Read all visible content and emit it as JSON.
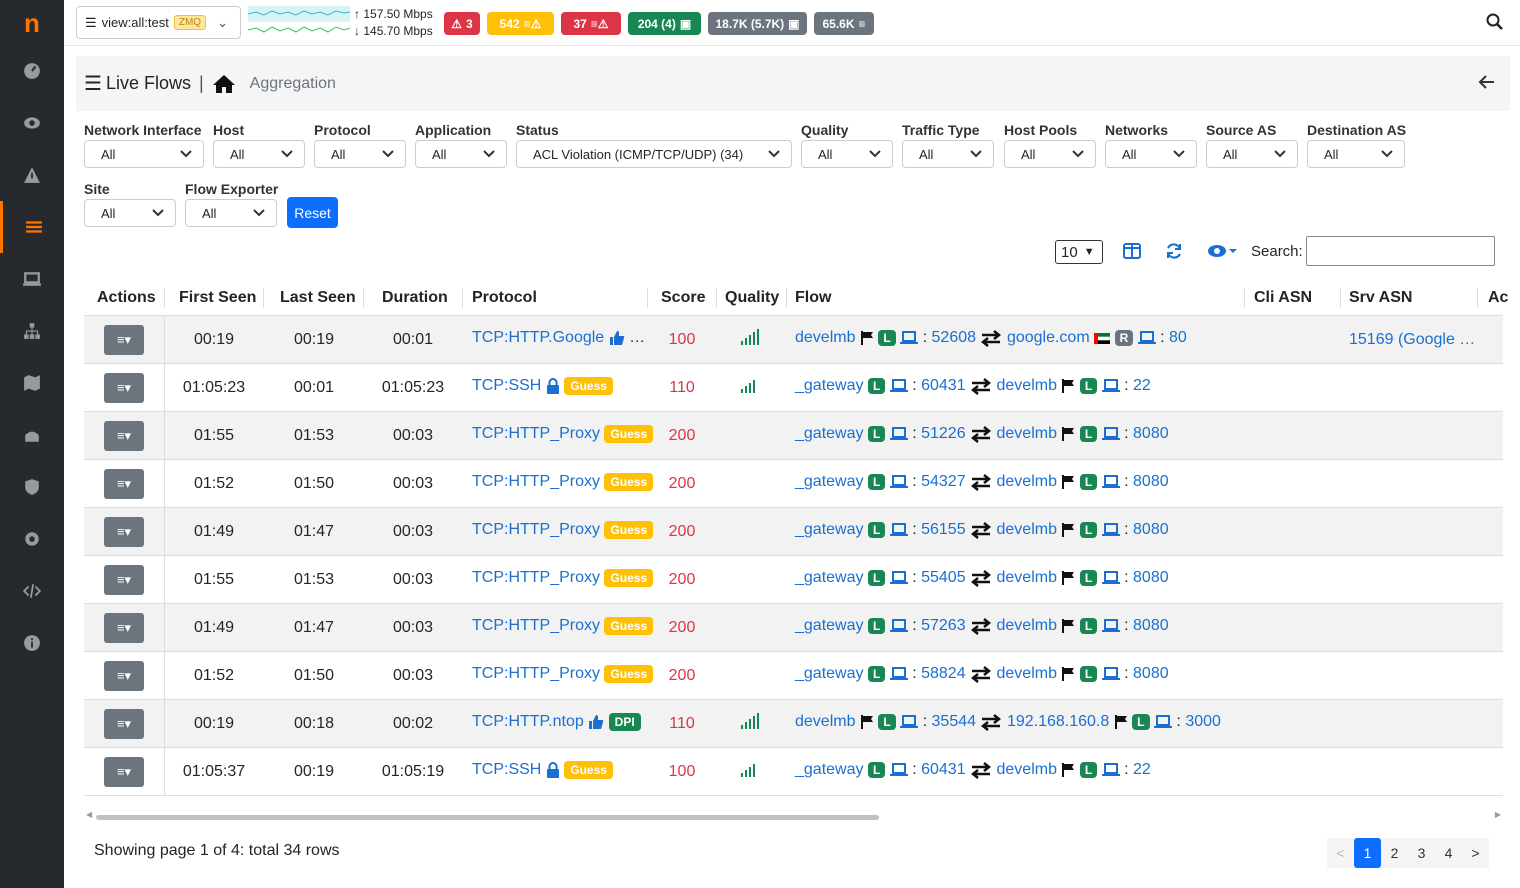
{
  "app": {
    "logo": "n"
  },
  "topbar": {
    "interface": "view:all:test",
    "interface_tag": "ZMQ",
    "upload": "157.50 Mbps",
    "download": "145.70 Mbps",
    "badges": [
      {
        "text": "3",
        "color": "#dc3545",
        "icon": "warning-icon"
      },
      {
        "text": "542",
        "color": "#ffc107",
        "icon": "list-warning-icon"
      },
      {
        "text": "37",
        "color": "#dc3545",
        "icon": "list-warning-icon"
      },
      {
        "text": "204 (4)",
        "color": "#198754",
        "icon": "laptop-icon"
      },
      {
        "text": "18.7K (5.7K)",
        "color": "#6c757d",
        "icon": "laptop-icon"
      },
      {
        "text": "65.6K",
        "color": "#6c757d",
        "icon": "list-icon"
      }
    ]
  },
  "breadcrumb": {
    "title": "Live Flows",
    "sep": "|",
    "sub": "Aggregation"
  },
  "filters": {
    "labels": {
      "network_interface": "Network Interface",
      "host": "Host",
      "protocol": "Protocol",
      "application": "Application",
      "status": "Status",
      "quality": "Quality",
      "traffic_type": "Traffic Type",
      "host_pools": "Host Pools",
      "networks": "Networks",
      "source_as": "Source AS",
      "destination_as": "Destination AS",
      "site": "Site",
      "flow_exporter": "Flow Exporter"
    },
    "values": {
      "network_interface": "All",
      "host": "All",
      "protocol": "All",
      "application": "All",
      "status": "ACL Violation (ICMP/TCP/UDP) (34)",
      "quality": "All",
      "traffic_type": "All",
      "host_pools": "All",
      "networks": "All",
      "source_as": "All",
      "destination_as": "All",
      "site": "All",
      "flow_exporter": "All"
    },
    "reset_label": "Reset"
  },
  "toolbar": {
    "per_page": "10",
    "search_label": "Search:"
  },
  "table": {
    "headers": {
      "actions": "Actions",
      "first_seen": "First Seen",
      "last_seen": "Last Seen",
      "duration": "Duration",
      "protocol": "Protocol",
      "score": "Score",
      "quality": "Quality",
      "flow": "Flow",
      "cli_asn": "Cli ASN",
      "srv_asn": "Srv ASN",
      "more": "Ac"
    },
    "rows": [
      {
        "first": "00:19",
        "last": "00:19",
        "dur": "00:01",
        "proto": "TCP:HTTP.Google",
        "tag": "thumb",
        "score": "100",
        "quality": 4,
        "cli": "develmb",
        "cli_badge": "L",
        "cport": "52608",
        "srv": "google.com",
        "srv_badge": "R",
        "sport": "80",
        "srv_asn": "15169 (Google …"
      },
      {
        "first": "01:05:23",
        "last": "00:01",
        "dur": "01:05:23",
        "proto": "TCP:SSH",
        "tag": "Guess",
        "score": "110",
        "quality": 3,
        "cli": "_gateway",
        "cli_badge": "L",
        "cport": "60431",
        "srv": "develmb",
        "srv_badge": "L",
        "sport": "22",
        "srv_asn": ""
      },
      {
        "first": "01:55",
        "last": "01:53",
        "dur": "00:03",
        "proto": "TCP:HTTP_Proxy",
        "tag": "Guess",
        "score": "200",
        "quality": 0,
        "cli": "_gateway",
        "cli_badge": "L",
        "cport": "51226",
        "srv": "develmb",
        "srv_badge": "L",
        "sport": "8080",
        "srv_asn": ""
      },
      {
        "first": "01:52",
        "last": "01:50",
        "dur": "00:03",
        "proto": "TCP:HTTP_Proxy",
        "tag": "Guess",
        "score": "200",
        "quality": 0,
        "cli": "_gateway",
        "cli_badge": "L",
        "cport": "54327",
        "srv": "develmb",
        "srv_badge": "L",
        "sport": "8080",
        "srv_asn": ""
      },
      {
        "first": "01:49",
        "last": "01:47",
        "dur": "00:03",
        "proto": "TCP:HTTP_Proxy",
        "tag": "Guess",
        "score": "200",
        "quality": 0,
        "cli": "_gateway",
        "cli_badge": "L",
        "cport": "56155",
        "srv": "develmb",
        "srv_badge": "L",
        "sport": "8080",
        "srv_asn": ""
      },
      {
        "first": "01:55",
        "last": "01:53",
        "dur": "00:03",
        "proto": "TCP:HTTP_Proxy",
        "tag": "Guess",
        "score": "200",
        "quality": 0,
        "cli": "_gateway",
        "cli_badge": "L",
        "cport": "55405",
        "srv": "develmb",
        "srv_badge": "L",
        "sport": "8080",
        "srv_asn": ""
      },
      {
        "first": "01:49",
        "last": "01:47",
        "dur": "00:03",
        "proto": "TCP:HTTP_Proxy",
        "tag": "Guess",
        "score": "200",
        "quality": 0,
        "cli": "_gateway",
        "cli_badge": "L",
        "cport": "57263",
        "srv": "develmb",
        "srv_badge": "L",
        "sport": "8080",
        "srv_asn": ""
      },
      {
        "first": "01:52",
        "last": "01:50",
        "dur": "00:03",
        "proto": "TCP:HTTP_Proxy",
        "tag": "Guess",
        "score": "200",
        "quality": 0,
        "cli": "_gateway",
        "cli_badge": "L",
        "cport": "58824",
        "srv": "develmb",
        "srv_badge": "L",
        "sport": "8080",
        "srv_asn": ""
      },
      {
        "first": "00:19",
        "last": "00:18",
        "dur": "00:02",
        "proto": "TCP:HTTP.ntop",
        "tag": "DPI",
        "score": "110",
        "quality": 4,
        "cli": "develmb",
        "cli_badge": "L",
        "cport": "35544",
        "srv": "192.168.160.8",
        "srv_badge": "L",
        "sport": "3000",
        "srv_asn": ""
      },
      {
        "first": "01:05:37",
        "last": "00:19",
        "dur": "01:05:19",
        "proto": "TCP:SSH",
        "tag": "Guess",
        "score": "100",
        "quality": 3,
        "cli": "_gateway",
        "cli_badge": "L",
        "cport": "60431",
        "srv": "develmb",
        "srv_badge": "L",
        "sport": "22",
        "srv_asn": ""
      }
    ]
  },
  "footer": {
    "info": "Showing page 1 of 4: total 34 rows",
    "pages": [
      "<",
      "1",
      "2",
      "3",
      "4",
      ">"
    ]
  }
}
